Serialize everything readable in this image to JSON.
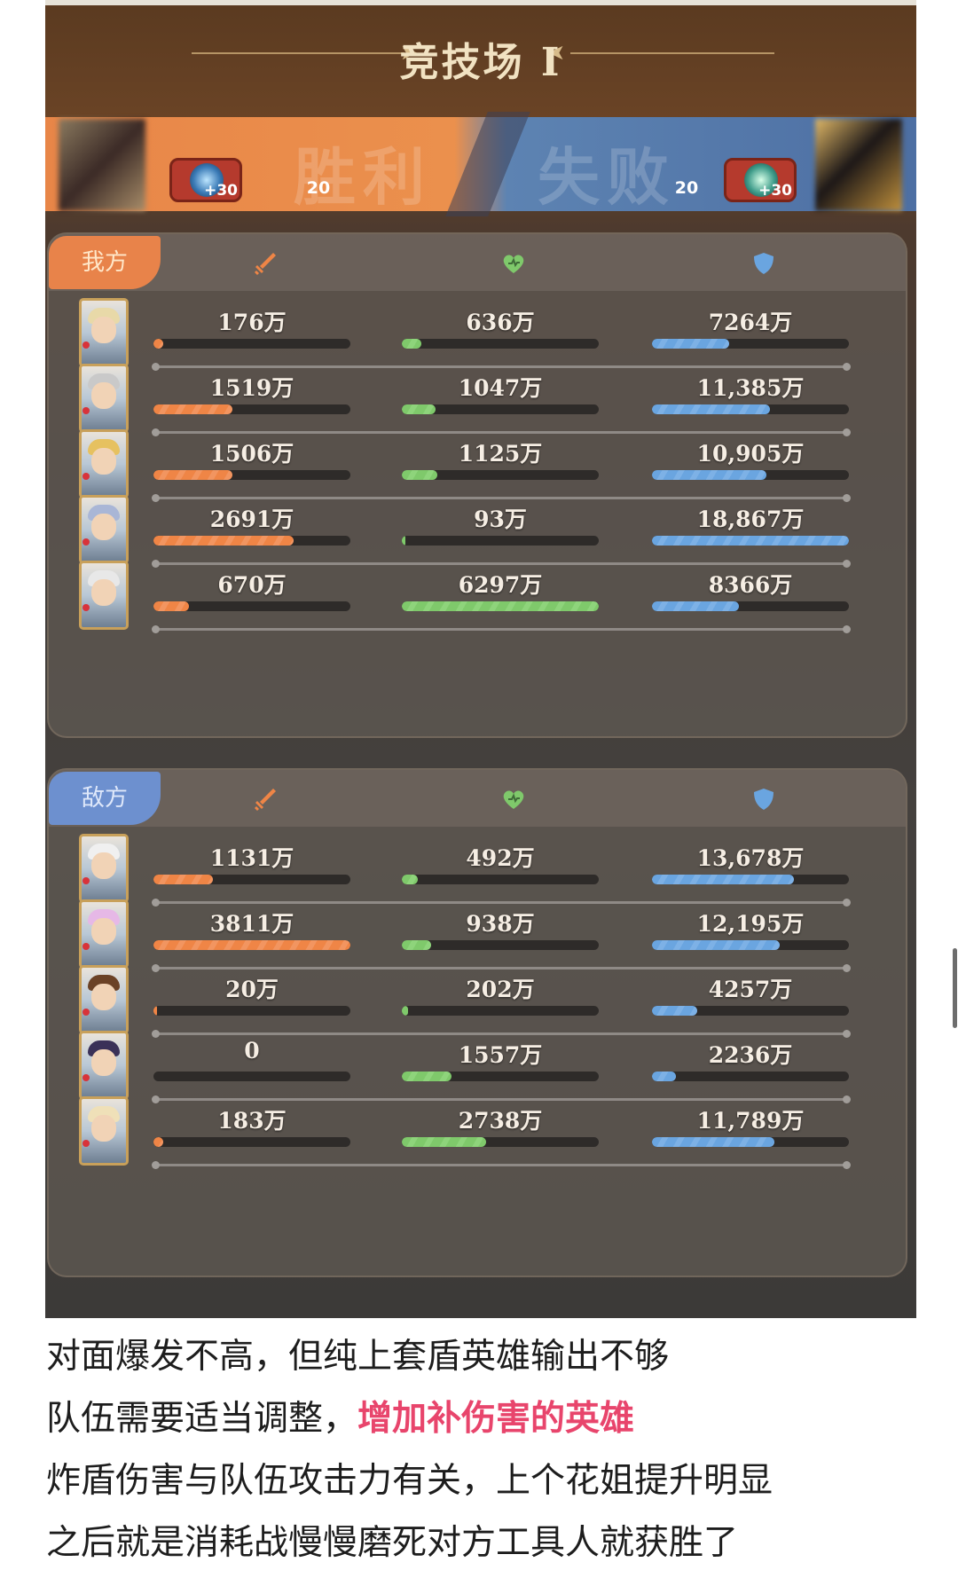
{
  "arena": {
    "title": "竞技场 I",
    "result_left": "胜利",
    "result_right": "失败"
  },
  "players": {
    "left": {
      "bonus": "+30",
      "level": "20"
    },
    "right": {
      "bonus": "+30",
      "level": "20"
    }
  },
  "colors": {
    "attack": "#ef8546",
    "heal": "#7fc96b",
    "shield": "#6aa5e0",
    "highlight": "#e8456c"
  },
  "icons": {
    "attack": "sword-icon",
    "heal": "heart-icon",
    "shield": "shield-icon"
  },
  "teams": [
    {
      "label": "我方",
      "heroes": [
        {
          "damage": "176万",
          "heal": "636万",
          "shield": "7264万",
          "damage_pct": 0.05,
          "heal_pct": 0.1,
          "shield_pct": 0.39
        },
        {
          "damage": "1519万",
          "heal": "1047万",
          "shield": "11,385万",
          "damage_pct": 0.4,
          "heal_pct": 0.17,
          "shield_pct": 0.6
        },
        {
          "damage": "1506万",
          "heal": "1125万",
          "shield": "10,905万",
          "damage_pct": 0.4,
          "heal_pct": 0.18,
          "shield_pct": 0.58
        },
        {
          "damage": "2691万",
          "heal": "93万",
          "shield": "18,867万",
          "damage_pct": 0.71,
          "heal_pct": 0.01,
          "shield_pct": 1.0
        },
        {
          "damage": "670万",
          "heal": "6297万",
          "shield": "8366万",
          "damage_pct": 0.18,
          "heal_pct": 1.0,
          "shield_pct": 0.44
        }
      ]
    },
    {
      "label": "敌方",
      "heroes": [
        {
          "damage": "1131万",
          "heal": "492万",
          "shield": "13,678万",
          "damage_pct": 0.3,
          "heal_pct": 0.08,
          "shield_pct": 0.72
        },
        {
          "damage": "3811万",
          "heal": "938万",
          "shield": "12,195万",
          "damage_pct": 1.0,
          "heal_pct": 0.15,
          "shield_pct": 0.65
        },
        {
          "damage": "20万",
          "heal": "202万",
          "shield": "4257万",
          "damage_pct": 0.005,
          "heal_pct": 0.03,
          "shield_pct": 0.23
        },
        {
          "damage": "0",
          "heal": "1557万",
          "shield": "2236万",
          "damage_pct": 0.0,
          "heal_pct": 0.25,
          "shield_pct": 0.12
        },
        {
          "damage": "183万",
          "heal": "2738万",
          "shield": "11,789万",
          "damage_pct": 0.05,
          "heal_pct": 0.43,
          "shield_pct": 0.62
        }
      ]
    }
  ],
  "caption": {
    "line1": "对面爆发不高，但纯上套盾英雄输出不够",
    "line2_prefix": "队伍需要适当调整，",
    "line2_highlight": "增加补伤害的英雄",
    "line3": "炸盾伤害与队伍攻击力有关，上个花姐提升明显",
    "line4": "之后就是消耗战慢慢磨死对方工具人就获胜了"
  }
}
